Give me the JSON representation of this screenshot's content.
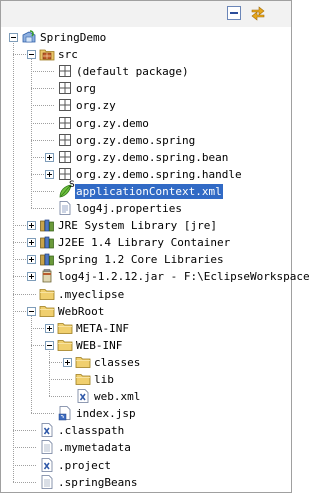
{
  "toolbar": {
    "collapse_icon": "collapse-all-icon",
    "link_icon": "link-with-editor-icon"
  },
  "tree": [
    {
      "label": "SpringDemo",
      "icon": "spring-project-icon",
      "toggle": "expanded"
    },
    {
      "label": "src",
      "icon": "source-folder-icon",
      "toggle": "expanded"
    },
    {
      "label": "(default package)",
      "icon": "package-icon",
      "toggle": "none"
    },
    {
      "label": "org",
      "icon": "package-icon",
      "toggle": "none"
    },
    {
      "label": "org.zy",
      "icon": "package-icon",
      "toggle": "none"
    },
    {
      "label": "org.zy.demo",
      "icon": "package-icon",
      "toggle": "none"
    },
    {
      "label": "org.zy.demo.spring",
      "icon": "package-icon",
      "toggle": "none"
    },
    {
      "label": "org.zy.demo.spring.bean",
      "icon": "package-icon",
      "toggle": "collapsed"
    },
    {
      "label": "org.zy.demo.spring.handle",
      "icon": "package-icon",
      "toggle": "collapsed"
    },
    {
      "label": "applicationContext.xml",
      "icon": "spring-config-icon",
      "toggle": "none",
      "badge": "S",
      "selected": true
    },
    {
      "label": "log4j.properties",
      "icon": "properties-file-icon",
      "toggle": "none"
    },
    {
      "label": "JRE System Library [jre]",
      "icon": "library-icon",
      "toggle": "collapsed"
    },
    {
      "label": "J2EE 1.4 Library Container",
      "icon": "library-icon",
      "toggle": "collapsed"
    },
    {
      "label": "Spring 1.2 Core Libraries",
      "icon": "library-icon",
      "toggle": "collapsed"
    },
    {
      "label": "log4j-1.2.12.jar - F:\\EclipseWorkspace",
      "icon": "jar-icon",
      "toggle": "collapsed"
    },
    {
      "label": ".myeclipse",
      "icon": "folder-icon",
      "toggle": "none"
    },
    {
      "label": "WebRoot",
      "icon": "folder-icon",
      "toggle": "expanded"
    },
    {
      "label": "META-INF",
      "icon": "folder-icon",
      "toggle": "collapsed"
    },
    {
      "label": "WEB-INF",
      "icon": "folder-icon",
      "toggle": "expanded"
    },
    {
      "label": "classes",
      "icon": "folder-icon",
      "toggle": "collapsed"
    },
    {
      "label": "lib",
      "icon": "folder-icon",
      "toggle": "none"
    },
    {
      "label": "web.xml",
      "icon": "xml-file-icon",
      "toggle": "none"
    },
    {
      "label": "index.jsp",
      "icon": "jsp-file-icon",
      "toggle": "none"
    },
    {
      "label": ".classpath",
      "icon": "xml-file-icon",
      "toggle": "none"
    },
    {
      "label": ".mymetadata",
      "icon": "text-file-icon",
      "toggle": "none"
    },
    {
      "label": ".project",
      "icon": "xml-file-icon",
      "toggle": "none"
    },
    {
      "label": ".springBeans",
      "icon": "text-file-icon",
      "toggle": "none"
    }
  ]
}
